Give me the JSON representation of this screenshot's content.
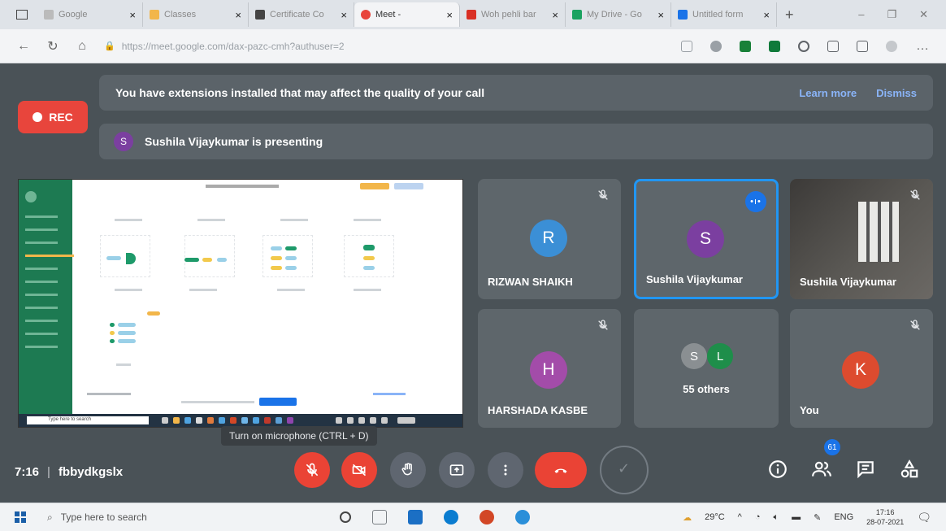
{
  "browser": {
    "tabs": [
      {
        "title": "Google",
        "favicon_color": "#bbbbbb",
        "active": false
      },
      {
        "title": "Classes",
        "favicon_color": "#f2b64a",
        "active": false
      },
      {
        "title": "Certificate Co",
        "favicon_color": "#444444",
        "active": false
      },
      {
        "title": "Meet -",
        "favicon_color": "#e8453c",
        "active": true
      },
      {
        "title": "Woh pehli bar",
        "favicon_color": "#d93025",
        "active": false
      },
      {
        "title": "My Drive - Go",
        "favicon_color": "#1aa260",
        "active": false
      },
      {
        "title": "Untitled form",
        "favicon_color": "#1a73e8",
        "active": false
      }
    ],
    "close_glyph": "×",
    "new_tab_glyph": "+",
    "url": "https://meet.google.com/dax-pazc-cmh?authuser=2",
    "ext_colors": [
      "#9aa0a6",
      "#9aa0a6",
      "#188038",
      "#188038",
      "#5f6368",
      "#5f6368",
      "#5f6368"
    ]
  },
  "meet": {
    "rec_label": "REC",
    "banner_text": "You have extensions installed that may affect the quality of your call",
    "learn_more": "Learn more",
    "dismiss": "Dismiss",
    "presenter_initial": "S",
    "presenting_text": "Sushila Vijaykumar is presenting",
    "taskbar_search_text": "Type here to search",
    "tiles": [
      {
        "name": "RIZWAN SHAIKH",
        "initial": "R",
        "avatar_color": "#3b8fd6",
        "muted": true
      },
      {
        "name": "Sushila Vijaykumar",
        "initial": "S",
        "avatar_color": "#7b3fa0",
        "speaking": true
      },
      {
        "name": "Sushila Vijaykumar",
        "video": true,
        "muted": true
      },
      {
        "name": "HARSHADA KASBE",
        "initial": "H",
        "avatar_color": "#a34ca9",
        "muted": true
      },
      {
        "name": "55 others",
        "initials": [
          "S",
          "L"
        ],
        "avatar_colors": [
          "#8a8f92",
          "#1e8e4a"
        ]
      },
      {
        "name": "You",
        "initial": "K",
        "avatar_color": "#dd4b2f",
        "muted": true
      }
    ],
    "tooltip": "Turn on microphone (CTRL + D)",
    "time": "7:16",
    "separator": "|",
    "meeting_code": "fbbydkgslx",
    "participant_count": "61",
    "speaking_glyph": "•ı•"
  },
  "taskbar": {
    "search_placeholder": "Type here to search",
    "temperature": "29°C",
    "language": "ENG",
    "time": "17:16",
    "date": "28-07-2021",
    "app_colors": [
      "#444444",
      "#7a7f84",
      "#1b6fc4",
      "#0a7cd0",
      "#d24726",
      "#2a8fd9"
    ]
  }
}
